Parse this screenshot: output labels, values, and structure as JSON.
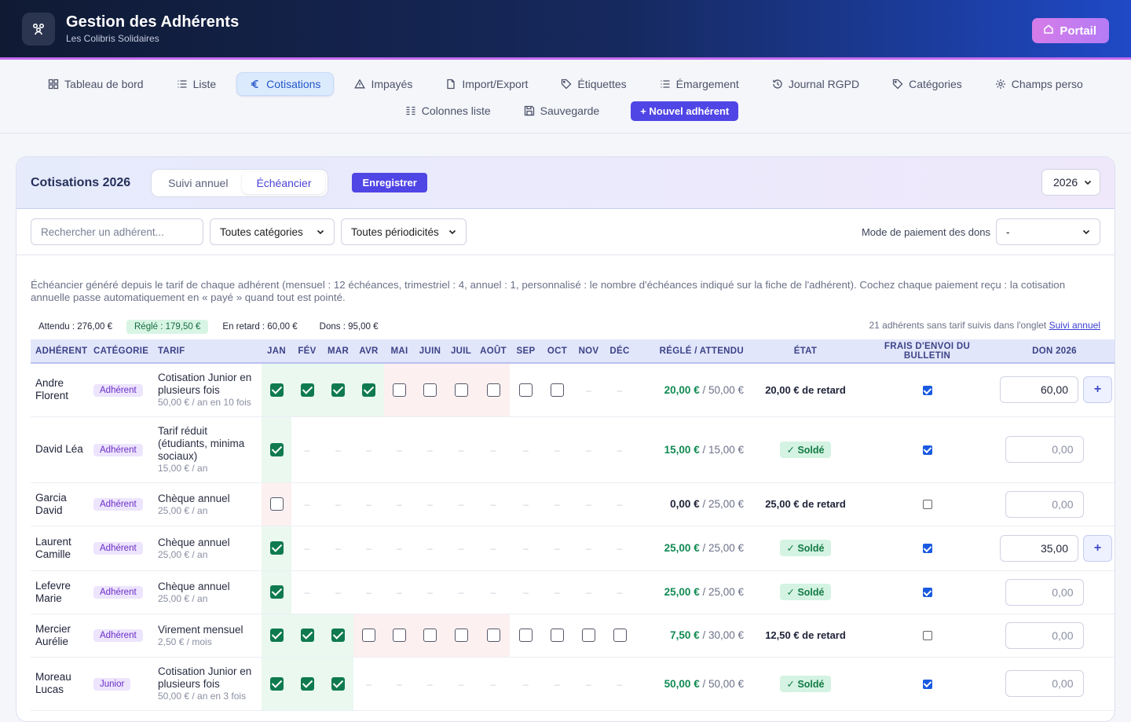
{
  "app": {
    "title": "Gestion des Adhérents",
    "subtitle": "Les Colibris Solidaires",
    "portal_label": "Portail"
  },
  "nav": {
    "row1": [
      {
        "label": "Tableau de bord",
        "icon": "grid-icon"
      },
      {
        "label": "Liste",
        "icon": "list-icon"
      },
      {
        "label": "Cotisations",
        "icon": "euro-icon",
        "active": true
      },
      {
        "label": "Impayés",
        "icon": "warning-icon"
      },
      {
        "label": "Import/Export",
        "icon": "file-icon"
      },
      {
        "label": "Étiquettes",
        "icon": "tag-icon"
      },
      {
        "label": "Émargement",
        "icon": "list-icon"
      },
      {
        "label": "Journal RGPD",
        "icon": "history-icon"
      },
      {
        "label": "Catégories",
        "icon": "tag-icon"
      },
      {
        "label": "Champs perso",
        "icon": "gear-icon"
      }
    ],
    "row2": [
      {
        "label": "Colonnes liste",
        "icon": "columns-icon"
      },
      {
        "label": "Sauvegarde",
        "icon": "save-icon"
      }
    ],
    "new_member": "+ Nouvel adhérent"
  },
  "panel": {
    "title": "Cotisations 2026",
    "tab_annual": "Suivi annuel",
    "tab_schedule": "Échéancier",
    "save": "Enregistrer",
    "year": "2026"
  },
  "filters": {
    "search_placeholder": "Rechercher un adhérent...",
    "category": "Toutes catégories",
    "periodicity": "Toutes périodicités",
    "donation_mode_label": "Mode de paiement des dons",
    "donation_mode_value": "-"
  },
  "intro": "Échéancier généré depuis le tarif de chaque adhérent (mensuel : 12 échéances, trimestriel : 4, annuel : 1, personnalisé : le nombre d'échéances indiqué sur la fiche de l'adhérent). Cochez chaque paiement reçu : la cotisation annuelle passe automatiquement en « payé » quand tout est pointé.",
  "summary": {
    "expected": "Attendu : 276,00 €",
    "paid": "Réglé : 179,50 €",
    "late": "En retard : 60,00 €",
    "donations": "Dons : 95,00 €",
    "untracked": "21 adhérents sans tarif suivis dans l'onglet",
    "untracked_link": "Suivi annuel"
  },
  "table": {
    "headers": {
      "member": "ADHÉRENT",
      "category": "CATÉGORIE",
      "tarif": "TARIF",
      "months": [
        "JAN",
        "FÉV",
        "MAR",
        "AVR",
        "MAI",
        "JUIN",
        "JUIL",
        "AOÛT",
        "SEP",
        "OCT",
        "NOV",
        "DÉC"
      ],
      "paid": "RÉGLÉ / ATTENDU",
      "state": "ÉTAT",
      "fees": "FRAIS D'ENVOI DU BULLETIN",
      "don": "DON 2026"
    },
    "rows": [
      {
        "name": "Andre Florent",
        "category": "Adhérent",
        "tarif": "Cotisation Junior en plusieurs fois",
        "tarif_sub": "50,00 € / an en 10 fois",
        "months": [
          "on",
          "on",
          "on",
          "on",
          "off",
          "off",
          "off",
          "off",
          "off",
          "off",
          "-",
          "-"
        ],
        "bg": [
          "g",
          "g",
          "g",
          "g",
          "r",
          "r",
          "r",
          "r",
          "",
          "",
          "",
          ""
        ],
        "paid": "20,00 €",
        "due": " / 50,00 €",
        "state": "20,00 € de retard",
        "solde": false,
        "fees": true,
        "don": "60,00",
        "plus": true
      },
      {
        "name": "David Léa",
        "category": "Adhérent",
        "tarif": "Tarif réduit (étudiants, minima sociaux)",
        "tarif_sub": "15,00 € / an",
        "months": [
          "on",
          "-",
          "-",
          "-",
          "-",
          "-",
          "-",
          "-",
          "-",
          "-",
          "-",
          "-"
        ],
        "bg": [
          "g",
          "",
          "",
          "",
          "",
          "",
          "",
          "",
          "",
          "",
          "",
          ""
        ],
        "paid": "15,00 €",
        "due": " / 15,00 €",
        "state": "✓ Soldé",
        "solde": true,
        "fees": true,
        "don": "0,00",
        "plus": false
      },
      {
        "name": "Garcia David",
        "category": "Adhérent",
        "tarif": "Chèque annuel",
        "tarif_sub": "25,00 € / an",
        "months": [
          "off",
          "-",
          "-",
          "-",
          "-",
          "-",
          "-",
          "-",
          "-",
          "-",
          "-",
          "-"
        ],
        "bg": [
          "r",
          "",
          "",
          "",
          "",
          "",
          "",
          "",
          "",
          "",
          "",
          ""
        ],
        "paid": "0,00 €",
        "due": " / 25,00 €",
        "state": "25,00 € de retard",
        "solde": false,
        "fees": false,
        "don": "0,00",
        "plus": false
      },
      {
        "name": "Laurent Camille",
        "category": "Adhérent",
        "tarif": "Chèque annuel",
        "tarif_sub": "25,00 € / an",
        "months": [
          "on",
          "-",
          "-",
          "-",
          "-",
          "-",
          "-",
          "-",
          "-",
          "-",
          "-",
          "-"
        ],
        "bg": [
          "g",
          "",
          "",
          "",
          "",
          "",
          "",
          "",
          "",
          "",
          "",
          ""
        ],
        "paid": "25,00 €",
        "due": " / 25,00 €",
        "state": "✓ Soldé",
        "solde": true,
        "fees": true,
        "don": "35,00",
        "plus": true
      },
      {
        "name": "Lefevre Marie",
        "category": "Adhérent",
        "tarif": "Chèque annuel",
        "tarif_sub": "25,00 € / an",
        "months": [
          "on",
          "-",
          "-",
          "-",
          "-",
          "-",
          "-",
          "-",
          "-",
          "-",
          "-",
          "-"
        ],
        "bg": [
          "g",
          "",
          "",
          "",
          "",
          "",
          "",
          "",
          "",
          "",
          "",
          ""
        ],
        "paid": "25,00 €",
        "due": " / 25,00 €",
        "state": "✓ Soldé",
        "solde": true,
        "fees": true,
        "don": "0,00",
        "plus": false
      },
      {
        "name": "Mercier Aurélie",
        "category": "Adhérent",
        "tarif": "Virement mensuel",
        "tarif_sub": "2,50 € / mois",
        "months": [
          "on",
          "on",
          "on",
          "off",
          "off",
          "off",
          "off",
          "off",
          "off",
          "off",
          "off",
          "off"
        ],
        "bg": [
          "g",
          "g",
          "g",
          "r",
          "r",
          "r",
          "r",
          "r",
          "",
          "",
          "",
          ""
        ],
        "paid": "7,50 €",
        "due": " / 30,00 €",
        "state": "12,50 € de retard",
        "solde": false,
        "fees": false,
        "don": "0,00",
        "plus": false
      },
      {
        "name": "Moreau Lucas",
        "category": "Junior",
        "tarif": "Cotisation Junior en plusieurs fois",
        "tarif_sub": "50,00 € / an en 3 fois",
        "months": [
          "on",
          "on",
          "on",
          "-",
          "-",
          "-",
          "-",
          "-",
          "-",
          "-",
          "-",
          "-"
        ],
        "bg": [
          "g",
          "g",
          "g",
          "",
          "",
          "",
          "",
          "",
          "",
          "",
          "",
          ""
        ],
        "paid": "50,00 €",
        "due": " / 50,00 €",
        "state": "✓ Soldé",
        "solde": true,
        "fees": true,
        "don": "0,00",
        "plus": false
      }
    ]
  }
}
